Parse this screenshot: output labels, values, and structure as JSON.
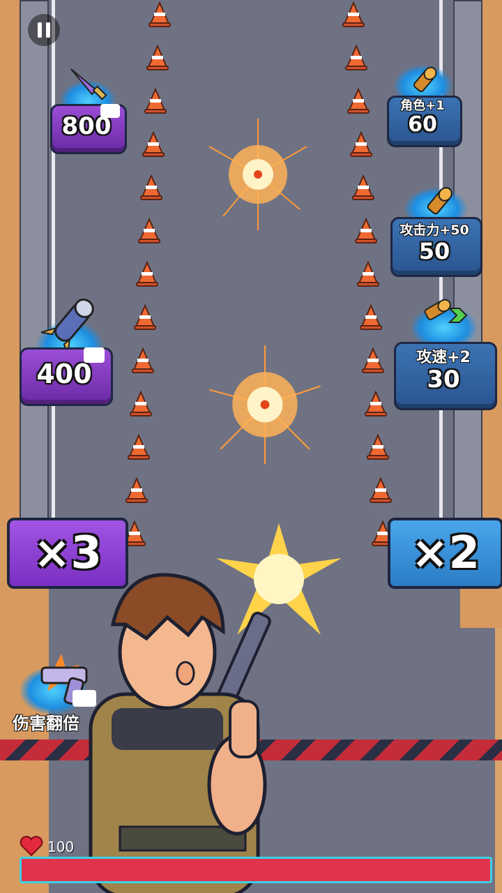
{
  "hud": {
    "pause_icon": "pause-icon",
    "health_value": "100",
    "health_fraction": 1.0,
    "heart_icon": "heart-icon"
  },
  "colors": {
    "gate_purple": "#8a3ccf",
    "gate_blue": "#2f8fd6",
    "health_bar": "#e2334c",
    "road": "#6f7283"
  },
  "left_pickups": [
    {
      "item": "knife-icon",
      "value": "800",
      "video_icon": "video-ad-icon"
    },
    {
      "item": "rocket-icon",
      "value": "400",
      "video_icon": "video-ad-icon"
    }
  ],
  "right_pickups": [
    {
      "label": "角色+1",
      "value": "60",
      "item": "bullet-icon"
    },
    {
      "label": "攻击力+50",
      "value": "50",
      "item": "bullet-icon"
    },
    {
      "label": "攻速+2",
      "value": "30",
      "item": "bullet-speed-icon"
    }
  ],
  "gates": {
    "left": "×3",
    "right": "×2"
  },
  "skill": {
    "label": "伤害翻倍",
    "item": "pistol-icon",
    "video_icon": "video-ad-icon"
  }
}
